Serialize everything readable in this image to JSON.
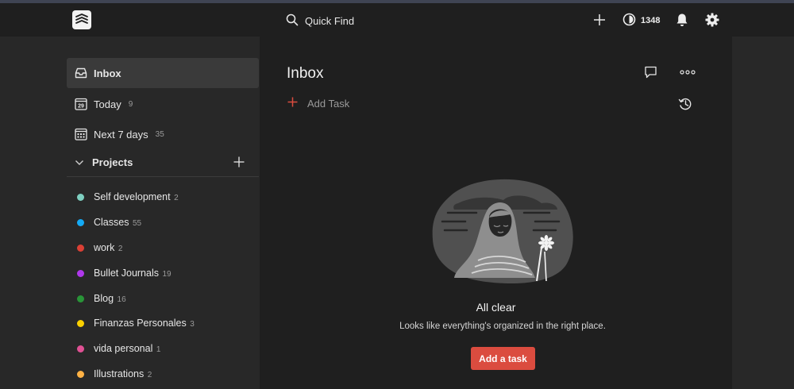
{
  "topbar": {
    "search_placeholder": "Quick Find",
    "karma_points": "1348"
  },
  "sidebar": {
    "nav": [
      {
        "label": "Inbox",
        "count": ""
      },
      {
        "label": "Today",
        "count": "9"
      },
      {
        "label": "Next 7 days",
        "count": "35"
      }
    ],
    "today_date": "29",
    "projects_label": "Projects",
    "projects": [
      {
        "label": "Self development",
        "count": "2",
        "color": "#7ecfc0"
      },
      {
        "label": "Classes",
        "count": "55",
        "color": "#14aaf5"
      },
      {
        "label": "work",
        "count": "2",
        "color": "#db4035"
      },
      {
        "label": "Bullet Journals",
        "count": "19",
        "color": "#af38eb"
      },
      {
        "label": "Blog",
        "count": "16",
        "color": "#299438"
      },
      {
        "label": "Finanzas Personales",
        "count": "3",
        "color": "#fad000"
      },
      {
        "label": "vida personal",
        "count": "1",
        "color": "#e05194"
      },
      {
        "label": "Illustrations",
        "count": "2",
        "color": "#ffb245"
      }
    ]
  },
  "main": {
    "title": "Inbox",
    "add_task_label": "Add Task",
    "empty_title": "All clear",
    "empty_subtitle": "Looks like everything's organized in the right place.",
    "add_button_label": "Add a task"
  },
  "colors": {
    "accent": "#db4c3f",
    "topbar_bg": "#1f1f1f",
    "sidebar_bg": "#282828",
    "main_bg": "#1f1f1f"
  }
}
